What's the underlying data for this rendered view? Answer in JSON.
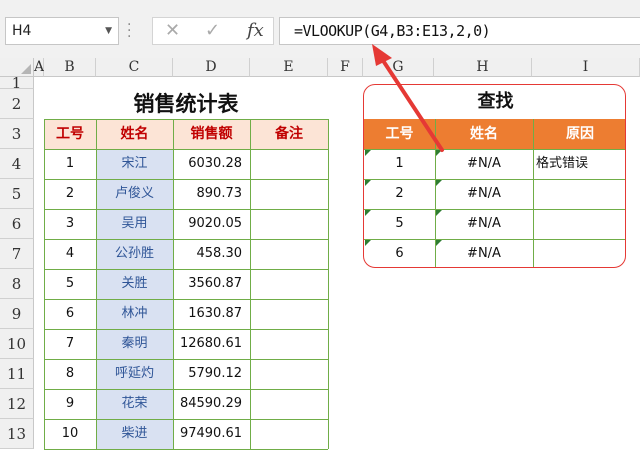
{
  "formula_bar": {
    "name_box": "H4",
    "formula": "=VLOOKUP(G4,B3:E13,2,0)",
    "cancel_icon": "close-icon",
    "enter_icon": "check-icon",
    "fx_label": "fx"
  },
  "columns": [
    "A",
    "B",
    "C",
    "D",
    "E",
    "F",
    "G",
    "H",
    "I"
  ],
  "rows": [
    "1",
    "2",
    "3",
    "4",
    "5",
    "6",
    "7",
    "8",
    "9",
    "10",
    "11",
    "12",
    "13"
  ],
  "sales_table": {
    "title": "销售统计表",
    "headers": [
      "工号",
      "姓名",
      "销售额",
      "备注"
    ],
    "rows": [
      {
        "id": "1",
        "name": "宋江",
        "amount": "6030.28",
        "note": ""
      },
      {
        "id": "2",
        "name": "卢俊义",
        "amount": "890.73",
        "note": ""
      },
      {
        "id": "3",
        "name": "吴用",
        "amount": "9020.05",
        "note": ""
      },
      {
        "id": "4",
        "name": "公孙胜",
        "amount": "458.30",
        "note": ""
      },
      {
        "id": "5",
        "name": "关胜",
        "amount": "3560.87",
        "note": ""
      },
      {
        "id": "6",
        "name": "林冲",
        "amount": "1630.87",
        "note": ""
      },
      {
        "id": "7",
        "name": "秦明",
        "amount": "12680.61",
        "note": ""
      },
      {
        "id": "8",
        "name": "呼延灼",
        "amount": "5790.12",
        "note": ""
      },
      {
        "id": "9",
        "name": "花荣",
        "amount": "84590.29",
        "note": ""
      },
      {
        "id": "10",
        "name": "柴进",
        "amount": "97490.61",
        "note": ""
      }
    ]
  },
  "lookup_table": {
    "title": "查找",
    "headers": [
      "工号",
      "姓名",
      "原因"
    ],
    "rows": [
      {
        "id": "1",
        "result": "#N/A",
        "reason": "格式错误"
      },
      {
        "id": "2",
        "result": "#N/A",
        "reason": ""
      },
      {
        "id": "5",
        "result": "#N/A",
        "reason": ""
      },
      {
        "id": "6",
        "result": "#N/A",
        "reason": ""
      }
    ]
  },
  "colors": {
    "sales_header_bg": "#fce4d6",
    "sales_header_text": "#c00000",
    "lookup_header_bg": "#ed7d31",
    "name_cell_bg": "#d9e1f2",
    "border_green": "#70ad47",
    "annotation_red": "#e53935"
  }
}
